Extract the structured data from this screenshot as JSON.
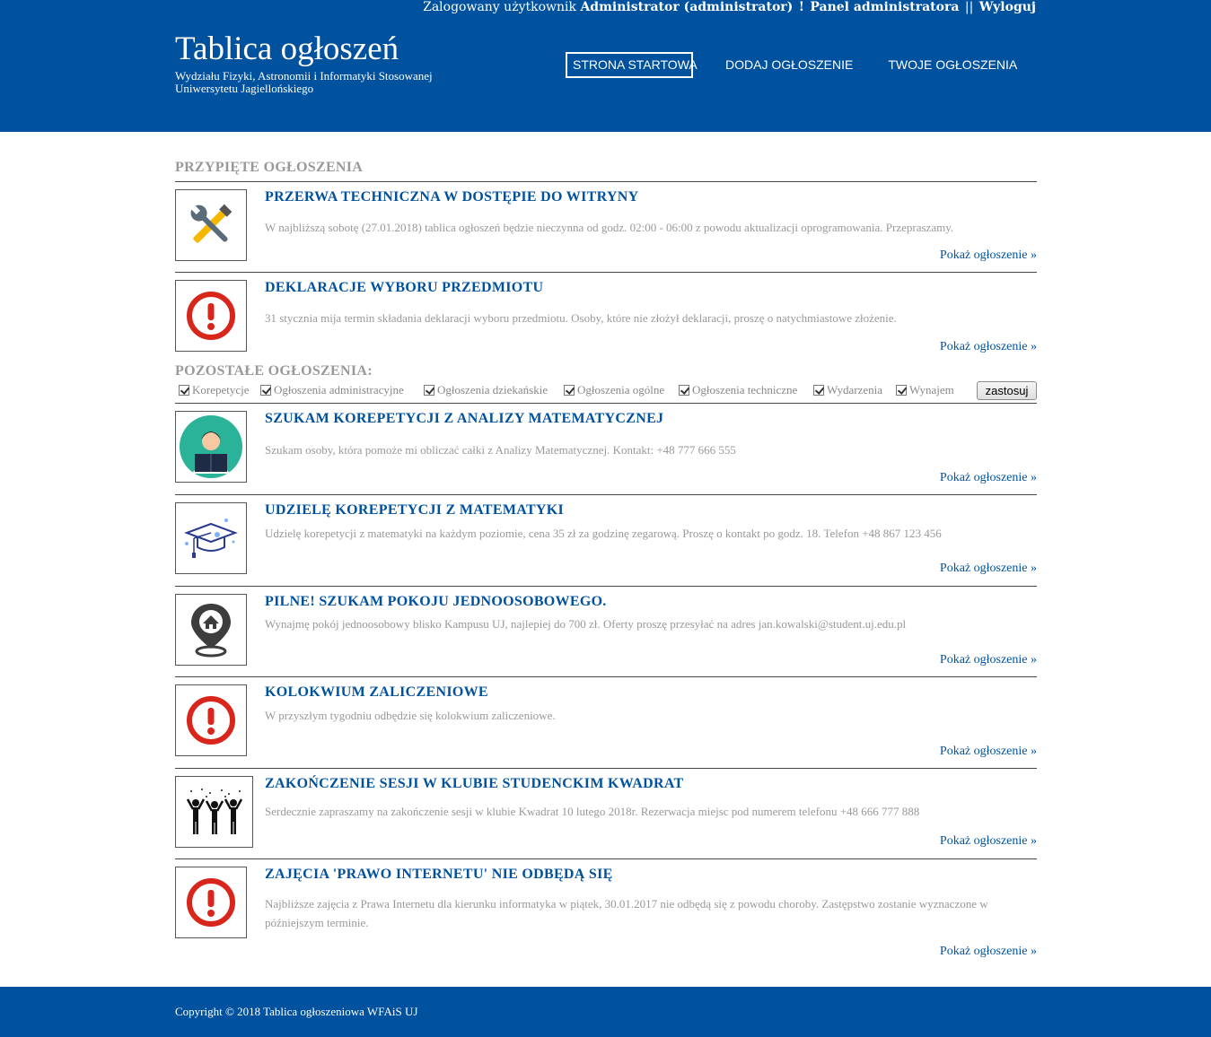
{
  "header": {
    "logged_in_prefix": "Zalogowany użytkownik",
    "user": "Administrator (administrator)",
    "separator1": "!",
    "admin_panel": "Panel administratora",
    "separator2": "||",
    "logout": "Wyloguj",
    "title": "Tablica ogłoszeń",
    "subtitle_line1": "Wydziału Fizyki, Astronomii i Informatyki Stosowanej",
    "subtitle_line2": "Uniwersytetu Jagiellońskiego"
  },
  "nav": {
    "home": "STRONA STARTOWA",
    "add": "DODAJ OGŁOSZENIE",
    "mine": "TWOJE OGŁOSZENIA"
  },
  "pinned": {
    "title": "PRZYPIĘTE OGŁOSZENIA",
    "posts": [
      {
        "icon": "tools-icon",
        "title": "PRZERWA TECHNICZNA W DOSTĘPIE DO WITRYNY",
        "desc": "W najbliższą sobotę (27.01.2018) tablica ogłoszeń będzie nieczynna od godz. 02:00 - 06:00 z powodu aktualizacji oprogramowania. Przepraszamy.",
        "more": "Pokaż ogłoszenie »"
      },
      {
        "icon": "alert-icon",
        "title": "DEKLARACJE WYBORU PRZEDMIOTU",
        "desc": "31 stycznia mija termin składania deklaracji wyboru przedmiotu. Osoby, które nie złożył deklaracji, proszę o natychmiastowe złożenie.",
        "more": "Pokaż ogłoszenie »"
      }
    ]
  },
  "other": {
    "title": "POZOSTAŁE OGŁOSZENIA:",
    "filters": [
      "Korepetycje",
      "Ogłoszenia administracyjne",
      "Ogłoszenia dziekańskie",
      "Ogłoszenia ogólne",
      "Ogłoszenia techniczne",
      "Wydarzenia",
      "Wynajem"
    ],
    "apply": "zastosuj",
    "posts": [
      {
        "icon": "student-icon",
        "title": "SZUKAM KOREPETYCJI Z ANALIZY MATEMATYCZNEJ",
        "desc": "Szukam osoby, która pomoże mi obliczać całki z Analizy Matematycznej. Kontakt: +48 777 666 555",
        "more": "Pokaż ogłoszenie »"
      },
      {
        "icon": "graduation-cap-icon",
        "title": "UDZIELĘ KOREPETYCJI Z MATEMATYKI",
        "desc": "Udzielę korepetycji z matematyki na każdym poziomie, cena 35 zł za godzinę zegarową. Proszę o kontakt po godz. 18. Telefon +48 867 123 456",
        "more": "Pokaż ogłoszenie »"
      },
      {
        "icon": "home-location-icon",
        "title": "PILNE! SZUKAM POKOJU JEDNOOSOBOWEGO.",
        "desc": "Wynajmę pokój jednoosobowy blisko Kampusu UJ, najlepiej do 700 zł. Oferty proszę przesyłać na adres jan.kowalski@student.uj.edu.pl",
        "more": "Pokaż ogłoszenie »"
      },
      {
        "icon": "alert-icon",
        "title": "KOLOKWIUM ZALICZENIOWE",
        "desc": "W przyszłym tygodniu odbędzie się kolokwium zaliczeniowe.",
        "more": "Pokaż ogłoszenie »"
      },
      {
        "icon": "party-icon",
        "title": "ZAKOŃCZENIE SESJI W KLUBIE STUDENCKIM KWADRAT",
        "desc": "Serdecznie zapraszamy na zakończenie sesji w klubie Kwadrat 10 lutego 2018r. Rezerwacja miejsc pod numerem telefonu +48 666 777 888",
        "more": "Pokaż ogłoszenie »"
      },
      {
        "icon": "alert-icon",
        "title": "ZAJĘCIA 'PRAWO INTERNETU' NIE ODBĘDĄ SIĘ",
        "desc": "Najbliższe zajęcia z Prawa Internetu dla kierunku informatyka w piątek, 30.01.2017 nie odbędą się z powodu choroby. Zastępstwo zostanie wyznaczone w późniejszym terminie.",
        "more": "Pokaż ogłoszenie »"
      }
    ]
  },
  "footer": {
    "copyright": "Copyright © 2018 Tablica ogłoszeniowa WFAiS UJ"
  },
  "colors": {
    "brand": "#00519e",
    "muted": "#999999",
    "alert_red": "#d9261c"
  }
}
